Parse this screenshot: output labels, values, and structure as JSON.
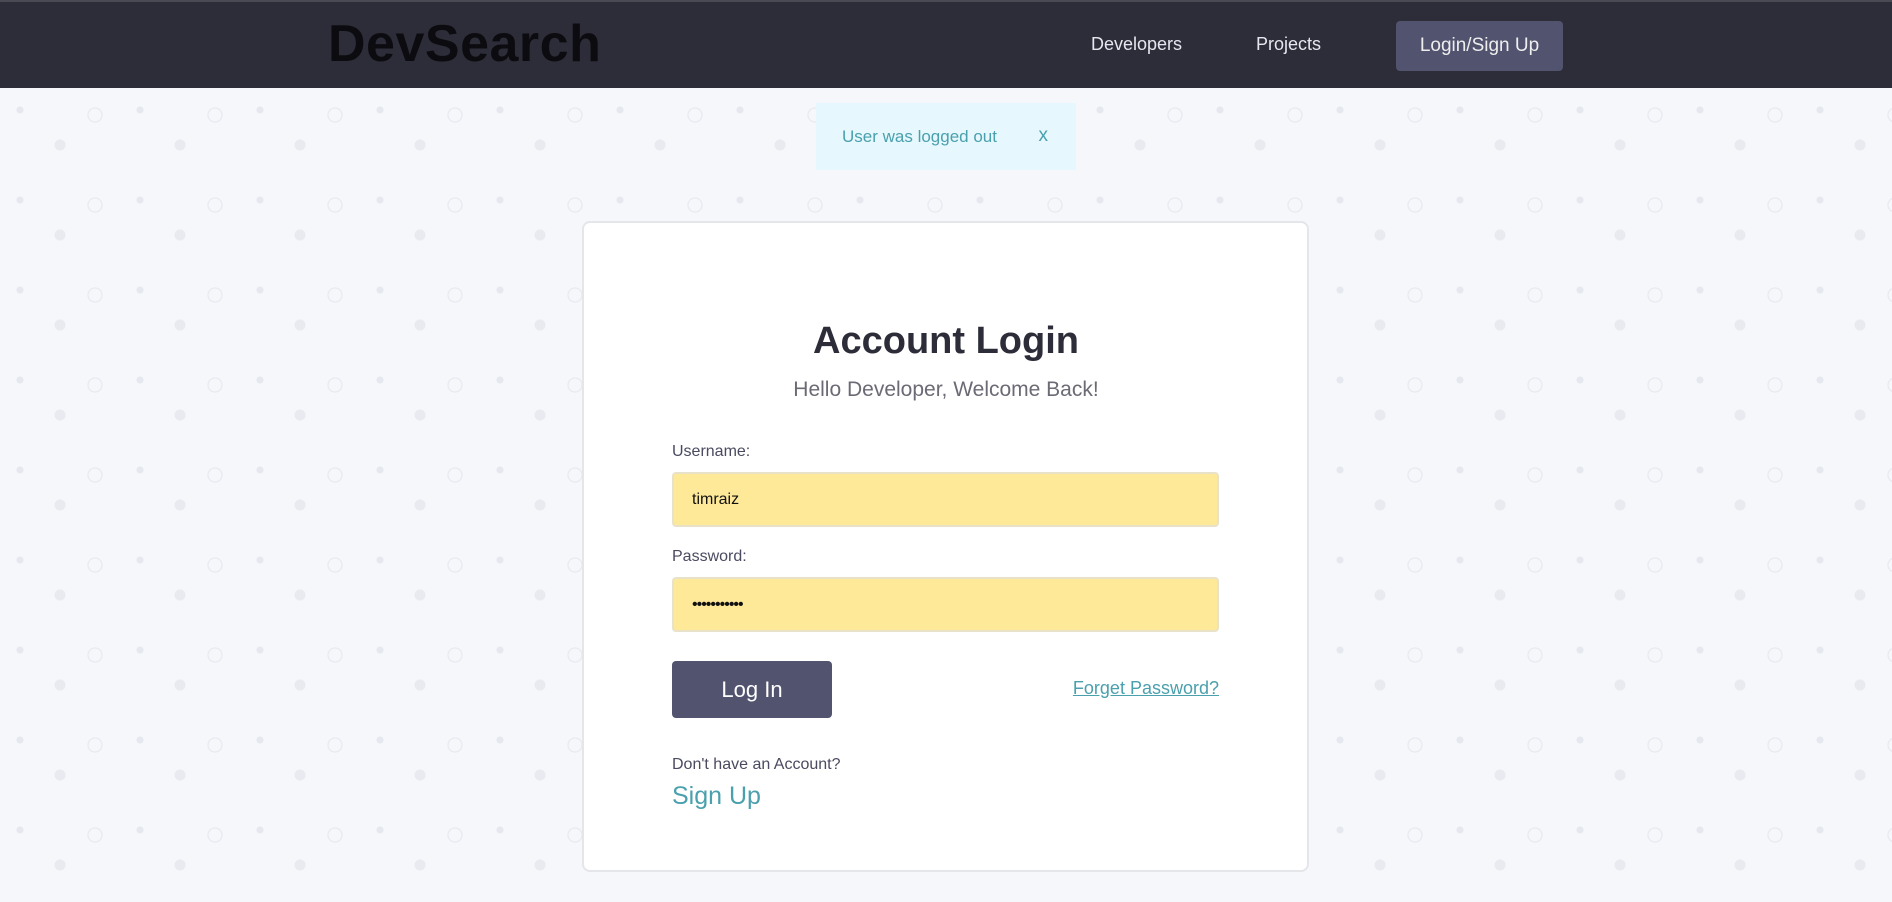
{
  "header": {
    "logo": "DevSearch",
    "nav": [
      {
        "label": "Developers"
      },
      {
        "label": "Projects"
      }
    ],
    "login_button": "Login/Sign Up"
  },
  "alert": {
    "message": "User was logged out",
    "close": "x"
  },
  "form": {
    "title": "Account Login",
    "subtitle": "Hello Developer, Welcome Back!",
    "username_label": "Username:",
    "username_value": "timraiz",
    "password_label": "Password:",
    "password_value": "•••••••••••",
    "login_button": "Log In",
    "forget_link": "Forget Password?",
    "no_account": "Don't have an Account?",
    "signup_link": "Sign Up"
  },
  "colors": {
    "header_bg": "#2d2d39",
    "accent": "#4aa0ad",
    "button": "#51536f",
    "input_bg": "#fee999"
  }
}
